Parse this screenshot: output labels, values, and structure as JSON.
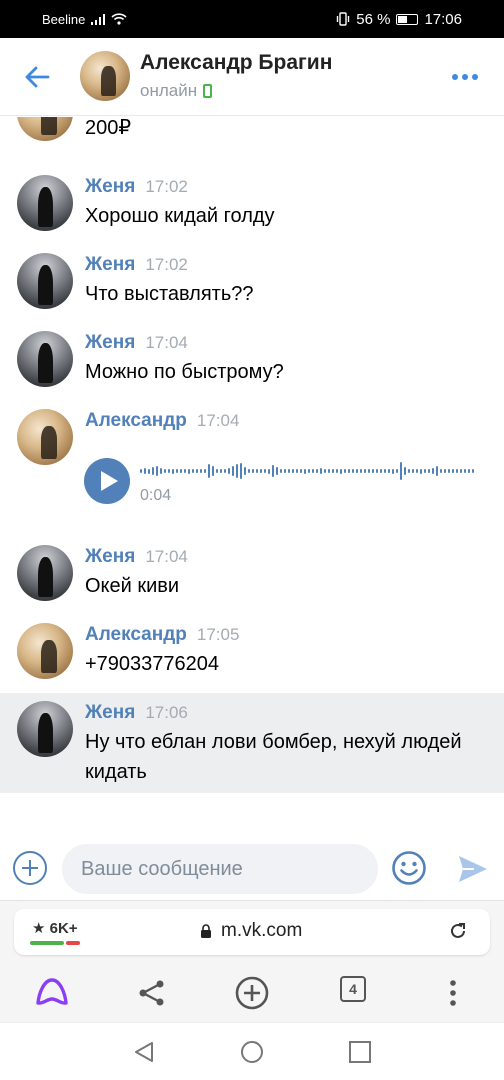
{
  "status_bar": {
    "carrier": "Beeline",
    "battery": "56 %",
    "time": "17:06"
  },
  "header": {
    "name": "Александр Брагин",
    "status": "онлайн"
  },
  "partial_message": {
    "text": "200₽"
  },
  "messages": [
    {
      "author": "Женя",
      "time": "17:02",
      "text": "Хорошо кидай голду"
    },
    {
      "author": "Женя",
      "time": "17:02",
      "text": "Что выставлять??"
    },
    {
      "author": "Женя",
      "time": "17:04",
      "text": "Можно по быстрому?"
    },
    {
      "author": "Александр",
      "time": "17:04",
      "voice_duration": "0:04"
    },
    {
      "author": "Женя",
      "time": "17:04",
      "text": "Окей киви"
    },
    {
      "author": "Александр",
      "time": "17:05",
      "text": "+79033776204"
    },
    {
      "author": "Женя",
      "time": "17:06",
      "text": "Ну что еблан лови бомбер, нехуй людей кидать"
    }
  ],
  "input": {
    "placeholder": "Ваше сообщение"
  },
  "browser": {
    "karma": "★ 6K+",
    "url": "m.vk.com",
    "tab_count": "4"
  },
  "colors": {
    "accent": "#5181b8",
    "online": "#4bb34b",
    "highlight_bg": "#edeef0"
  }
}
